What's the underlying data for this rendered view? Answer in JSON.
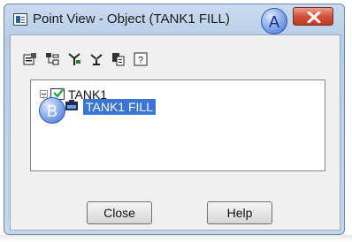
{
  "window": {
    "title": "Point View - Object (TANK1 FILL)",
    "close_icon": "close-x-icon"
  },
  "callouts": {
    "a": "A",
    "b": "B",
    "color": "#3d6fcf"
  },
  "toolbar": {
    "icons": [
      "properties-icon",
      "hierarchy-icon",
      "tree-icon",
      "parent-icon",
      "copy-icon",
      "help-icon"
    ]
  },
  "tree": {
    "root": {
      "label": "TANK1",
      "expanded": true,
      "icon": "checkbox-icon"
    },
    "child": {
      "label": "TANK1 FILL",
      "selected": true,
      "icon": "tank-point-icon"
    },
    "selection_color": "#3a75d6"
  },
  "buttons": {
    "close_label": "Close",
    "help_label": "Help"
  },
  "colors": {
    "title_gradient": "#c9dbef",
    "close_button": "#c03a22",
    "client_bg": "#f0f0f0"
  }
}
